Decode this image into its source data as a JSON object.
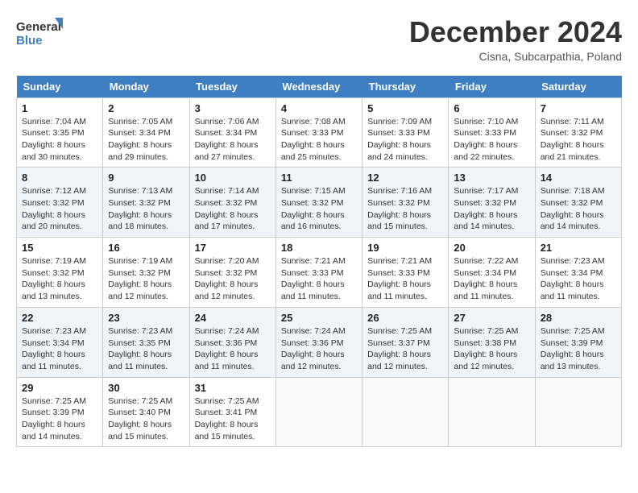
{
  "logo": {
    "line1": "General",
    "line2": "Blue"
  },
  "title": "December 2024",
  "location": "Cisna, Subcarpathia, Poland",
  "weekdays": [
    "Sunday",
    "Monday",
    "Tuesday",
    "Wednesday",
    "Thursday",
    "Friday",
    "Saturday"
  ],
  "weeks": [
    [
      {
        "day": "1",
        "sunrise": "7:04 AM",
        "sunset": "3:35 PM",
        "daylight": "8 hours and 30 minutes."
      },
      {
        "day": "2",
        "sunrise": "7:05 AM",
        "sunset": "3:34 PM",
        "daylight": "8 hours and 29 minutes."
      },
      {
        "day": "3",
        "sunrise": "7:06 AM",
        "sunset": "3:34 PM",
        "daylight": "8 hours and 27 minutes."
      },
      {
        "day": "4",
        "sunrise": "7:08 AM",
        "sunset": "3:33 PM",
        "daylight": "8 hours and 25 minutes."
      },
      {
        "day": "5",
        "sunrise": "7:09 AM",
        "sunset": "3:33 PM",
        "daylight": "8 hours and 24 minutes."
      },
      {
        "day": "6",
        "sunrise": "7:10 AM",
        "sunset": "3:33 PM",
        "daylight": "8 hours and 22 minutes."
      },
      {
        "day": "7",
        "sunrise": "7:11 AM",
        "sunset": "3:32 PM",
        "daylight": "8 hours and 21 minutes."
      }
    ],
    [
      {
        "day": "8",
        "sunrise": "7:12 AM",
        "sunset": "3:32 PM",
        "daylight": "8 hours and 20 minutes."
      },
      {
        "day": "9",
        "sunrise": "7:13 AM",
        "sunset": "3:32 PM",
        "daylight": "8 hours and 18 minutes."
      },
      {
        "day": "10",
        "sunrise": "7:14 AM",
        "sunset": "3:32 PM",
        "daylight": "8 hours and 17 minutes."
      },
      {
        "day": "11",
        "sunrise": "7:15 AM",
        "sunset": "3:32 PM",
        "daylight": "8 hours and 16 minutes."
      },
      {
        "day": "12",
        "sunrise": "7:16 AM",
        "sunset": "3:32 PM",
        "daylight": "8 hours and 15 minutes."
      },
      {
        "day": "13",
        "sunrise": "7:17 AM",
        "sunset": "3:32 PM",
        "daylight": "8 hours and 14 minutes."
      },
      {
        "day": "14",
        "sunrise": "7:18 AM",
        "sunset": "3:32 PM",
        "daylight": "8 hours and 14 minutes."
      }
    ],
    [
      {
        "day": "15",
        "sunrise": "7:19 AM",
        "sunset": "3:32 PM",
        "daylight": "8 hours and 13 minutes."
      },
      {
        "day": "16",
        "sunrise": "7:19 AM",
        "sunset": "3:32 PM",
        "daylight": "8 hours and 12 minutes."
      },
      {
        "day": "17",
        "sunrise": "7:20 AM",
        "sunset": "3:32 PM",
        "daylight": "8 hours and 12 minutes."
      },
      {
        "day": "18",
        "sunrise": "7:21 AM",
        "sunset": "3:33 PM",
        "daylight": "8 hours and 11 minutes."
      },
      {
        "day": "19",
        "sunrise": "7:21 AM",
        "sunset": "3:33 PM",
        "daylight": "8 hours and 11 minutes."
      },
      {
        "day": "20",
        "sunrise": "7:22 AM",
        "sunset": "3:34 PM",
        "daylight": "8 hours and 11 minutes."
      },
      {
        "day": "21",
        "sunrise": "7:23 AM",
        "sunset": "3:34 PM",
        "daylight": "8 hours and 11 minutes."
      }
    ],
    [
      {
        "day": "22",
        "sunrise": "7:23 AM",
        "sunset": "3:34 PM",
        "daylight": "8 hours and 11 minutes."
      },
      {
        "day": "23",
        "sunrise": "7:23 AM",
        "sunset": "3:35 PM",
        "daylight": "8 hours and 11 minutes."
      },
      {
        "day": "24",
        "sunrise": "7:24 AM",
        "sunset": "3:36 PM",
        "daylight": "8 hours and 11 minutes."
      },
      {
        "day": "25",
        "sunrise": "7:24 AM",
        "sunset": "3:36 PM",
        "daylight": "8 hours and 12 minutes."
      },
      {
        "day": "26",
        "sunrise": "7:25 AM",
        "sunset": "3:37 PM",
        "daylight": "8 hours and 12 minutes."
      },
      {
        "day": "27",
        "sunrise": "7:25 AM",
        "sunset": "3:38 PM",
        "daylight": "8 hours and 12 minutes."
      },
      {
        "day": "28",
        "sunrise": "7:25 AM",
        "sunset": "3:39 PM",
        "daylight": "8 hours and 13 minutes."
      }
    ],
    [
      {
        "day": "29",
        "sunrise": "7:25 AM",
        "sunset": "3:39 PM",
        "daylight": "8 hours and 14 minutes."
      },
      {
        "day": "30",
        "sunrise": "7:25 AM",
        "sunset": "3:40 PM",
        "daylight": "8 hours and 15 minutes."
      },
      {
        "day": "31",
        "sunrise": "7:25 AM",
        "sunset": "3:41 PM",
        "daylight": "8 hours and 15 minutes."
      },
      null,
      null,
      null,
      null
    ]
  ]
}
